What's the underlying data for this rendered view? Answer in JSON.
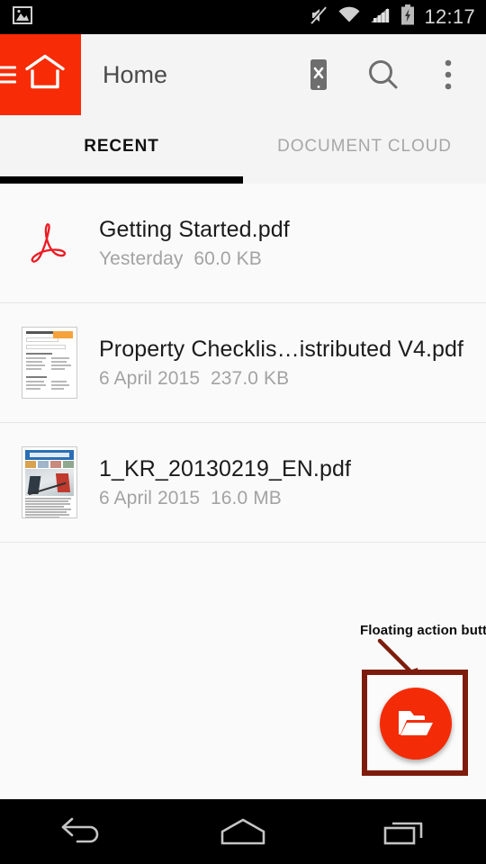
{
  "status_bar": {
    "time": "12:17",
    "icons": [
      "image-icon",
      "mute-icon",
      "wifi-icon",
      "signal-icon",
      "battery-charging-icon"
    ]
  },
  "app_bar": {
    "title": "Home",
    "nav_icons": [
      "hamburger-icon",
      "home-icon"
    ],
    "actions": [
      "phone-clear-icon",
      "search-icon",
      "overflow-menu-icon"
    ],
    "accent_color": "#f72b06"
  },
  "tabs": [
    {
      "label": "RECENT",
      "active": true
    },
    {
      "label": "DOCUMENT CLOUD",
      "active": false
    }
  ],
  "files": [
    {
      "name": "Getting Started.pdf",
      "date": "Yesterday",
      "size": "60.0 KB",
      "icon": "adobe-pdf-logo"
    },
    {
      "name": "Property Checklis…istributed V4.pdf",
      "date": "6 April 2015",
      "size": "237.0 KB",
      "icon": "document-thumbnail"
    },
    {
      "name": "1_KR_20130219_EN.pdf",
      "date": "6 April 2015",
      "size": "16.0 MB",
      "icon": "newspaper-thumbnail"
    }
  ],
  "annotation": {
    "label": "Floating action button",
    "arrow_color": "#7d1c0c",
    "box_color": "#7d1c0c"
  },
  "fab": {
    "icon": "open-folder-icon",
    "color": "#f42b07"
  },
  "nav_bar": {
    "buttons": [
      "back-icon",
      "home-icon",
      "recents-icon"
    ]
  }
}
